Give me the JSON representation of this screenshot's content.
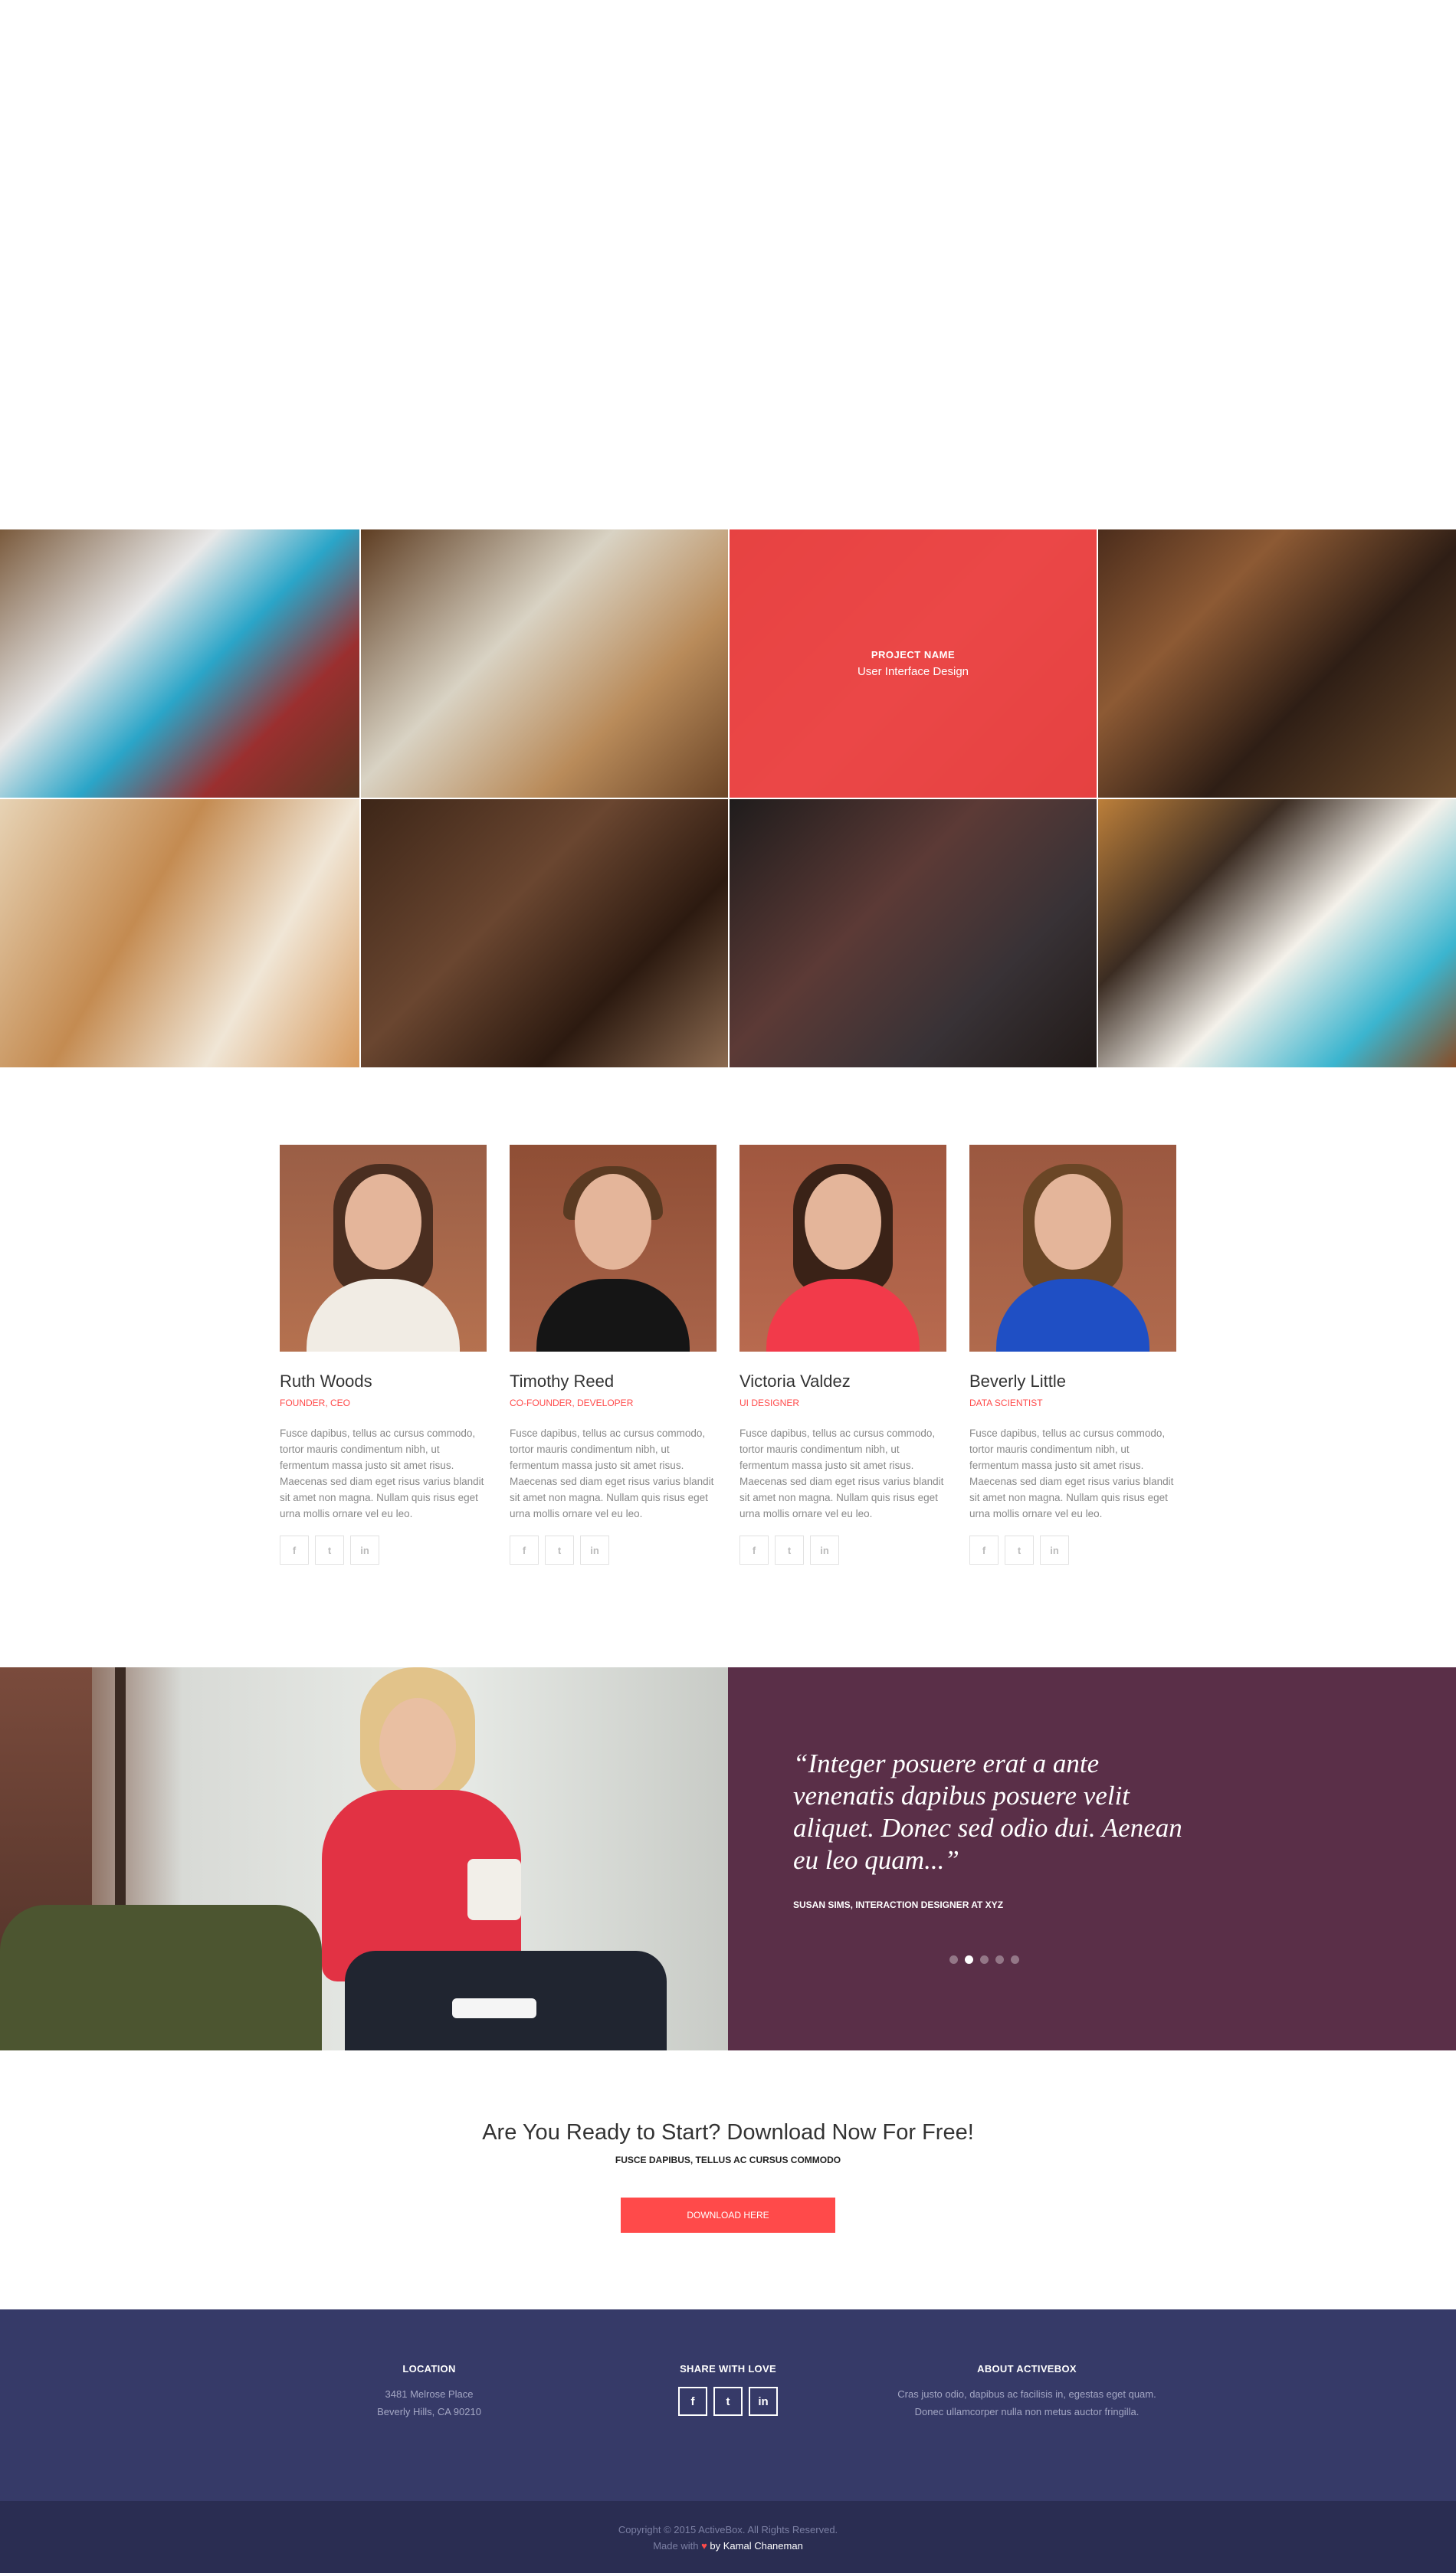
{
  "portfolio": {
    "hover_tile": {
      "project_name": "PROJECT NAME",
      "category": "User Interface Design"
    }
  },
  "team": [
    {
      "name": "Ruth Woods",
      "role": "FOUNDER, CEO",
      "bio": "Fusce dapibus, tellus ac cursus commodo, tortor mauris condimentum nibh, ut fermentum massa justo sit amet risus. Maecenas sed diam eget risus varius blandit sit amet non magna. Nullam quis risus eget urna mollis ornare vel eu leo."
    },
    {
      "name": "Timothy Reed",
      "role": "CO-FOUNDER, DEVELOPER",
      "bio": "Fusce dapibus, tellus ac cursus commodo, tortor mauris condimentum nibh, ut fermentum massa justo sit amet risus. Maecenas sed diam eget risus varius blandit sit amet non magna. Nullam quis risus eget urna mollis ornare vel eu leo."
    },
    {
      "name": "Victoria Valdez",
      "role": "UI DESIGNER",
      "bio": "Fusce dapibus, tellus ac cursus commodo, tortor mauris condimentum nibh, ut fermentum massa justo sit amet risus. Maecenas sed diam eget risus varius blandit sit amet non magna. Nullam quis risus eget urna mollis ornare vel eu leo."
    },
    {
      "name": "Beverly Little",
      "role": "DATA SCIENTIST",
      "bio": "Fusce dapibus, tellus ac cursus commodo, tortor mauris condimentum nibh, ut fermentum massa justo sit amet risus. Maecenas sed diam eget risus varius blandit sit amet non magna. Nullam quis risus eget urna mollis ornare vel eu leo."
    }
  ],
  "social_icons": [
    "facebook-icon",
    "twitter-icon",
    "linkedin-icon"
  ],
  "testimonial": {
    "quote": "“Integer posuere erat a ante venenatis dapibus posuere velit aliquet. Donec sed odio dui. Aenean eu leo quam...”",
    "author": "SUSAN SIMS, INTERACTION DESIGNER AT XYZ",
    "slides": 5,
    "active_slide": 2
  },
  "cta": {
    "title": "Are You Ready to Start? Download Now For Free!",
    "subtitle": "FUSCE DAPIBUS, TELLUS AC CURSUS COMMODO",
    "button": "DOWNLOAD HERE"
  },
  "footer": {
    "location": {
      "heading": "LOCATION",
      "line1": "3481 Melrose Place",
      "line2": "Beverly Hills, CA 90210"
    },
    "share": {
      "heading": "SHARE WITH LOVE",
      "icons": [
        "facebook-icon",
        "twitter-icon",
        "linkedin-icon"
      ]
    },
    "about": {
      "heading": "ABOUT ACTIVEBOX",
      "text": "Cras justo odio, dapibus ac facilisis in, egestas eget quam. Donec ullamcorper nulla non metus auctor fringilla."
    }
  },
  "bottom": {
    "copyright": "Copyright © 2015 ActiveBox. All Rights Reserved.",
    "made_with": "Made with",
    "by": "by Kamal Chaneman"
  },
  "colors": {
    "accent": "#ff4a4a",
    "testimonial_bg": "#5a2f48",
    "footer_bg": "#363a68",
    "bottom_bg": "#2a2d52"
  }
}
